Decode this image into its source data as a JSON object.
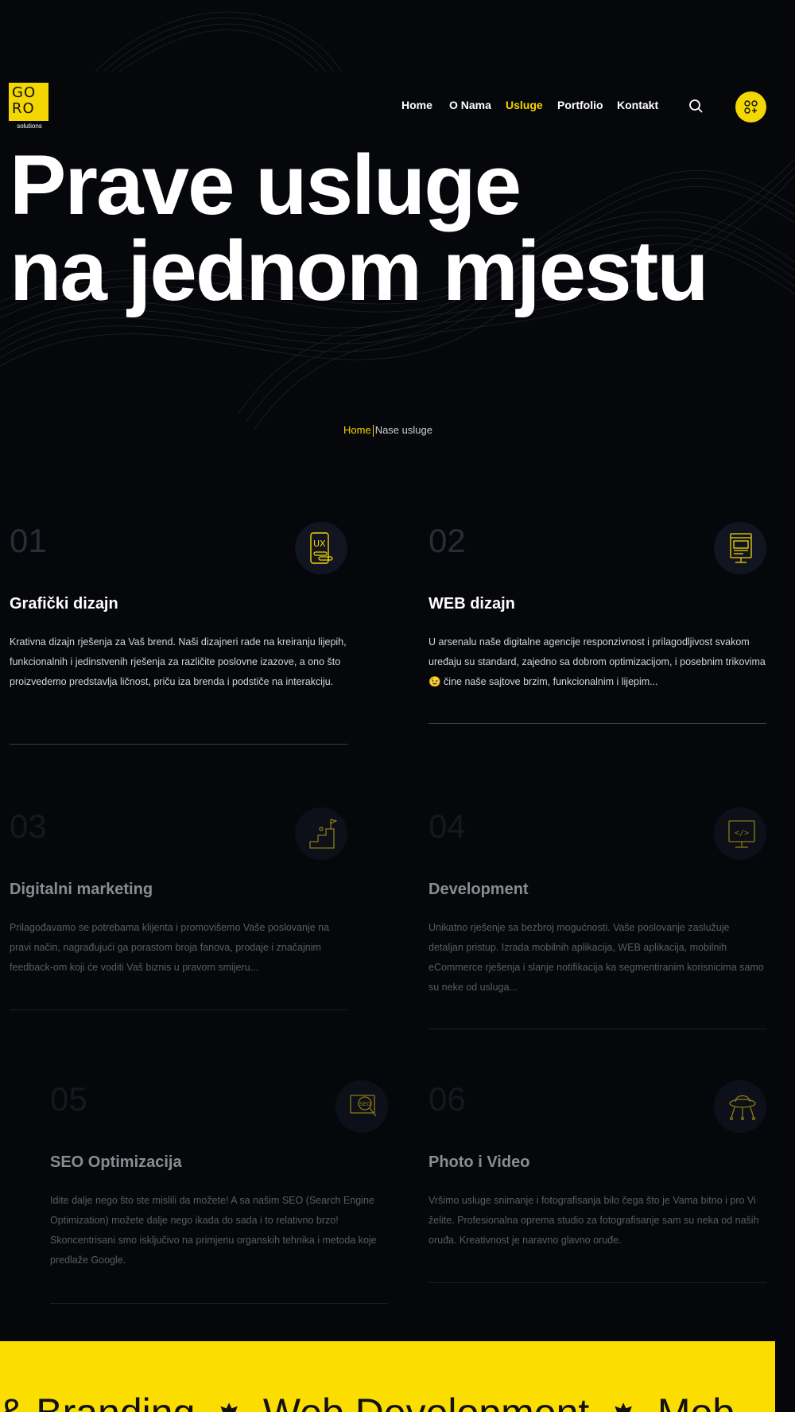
{
  "nav": {
    "logo_text": "GORO solutions",
    "items": [
      "Home",
      "O Nama",
      "Usluge",
      "Portfolio",
      "Kontakt"
    ],
    "active": "Usluge"
  },
  "hero": {
    "line1": "Prave usluge",
    "line2": "na jednom mjestu"
  },
  "breadcrumb": {
    "home": "Home",
    "current": "Nase usluge"
  },
  "services": [
    {
      "num": "01",
      "title": "Grafički dizajn",
      "icon": "ux-phone-icon",
      "text": "Krativna dizajn rješenja za Vaš brend. Naši dizajneri rade na kreiranju lijepih, funkcionalnih i jedinstvenih rješenja za različite poslovne izazove, a ono što proizvedemo predstavlja ličnost, priču iza brenda i podstiče na interakciju."
    },
    {
      "num": "02",
      "title": "WEB dizajn",
      "icon": "monitor-layout-icon",
      "text": "U arsenalu naše digitalne agencije responzivnost i prilagodljivost svakom uređaju su standard, zajedno sa dobrom optimizacijom, i posebnim trikovima 😉 čine naše sajtove brzim, funkcionalnim i lijepim..."
    },
    {
      "num": "03",
      "title": "Digitalni marketing",
      "icon": "climbing-flag-icon",
      "text": "Prilagođavamo se potrebama klijenta i promovišemo Vaše poslovanje na pravi način, nagrađujući ga porastom broja fanova, prodaje i značajnim feedback-om koji će voditi Vaš biznis u pravom smijeru..."
    },
    {
      "num": "04",
      "title": "Development",
      "icon": "code-monitor-icon",
      "text": "Unikatno rješenje sa bezbroj mogućnosti. Vaše poslovanje zaslužuje detaljan pristup. Izrada mobilnih aplikacija, WEB aplikacija, mobilnih eCommerce rješenja i slanje notifikacija ka segmentiranim korisnicima samo su neke od usluga..."
    },
    {
      "num": "05",
      "title": "SEO Optimizacija",
      "icon": "seo-magnifier-icon",
      "text": "Idite dalje nego što ste mislili da možete! A sa našim SEO (Search Engine Optimization) možete dalje nego ikada do sada i to relativno brzo! Skoncentrisani smo isključivo na primjenu organskih tehnika i metoda koje predlaže Google."
    },
    {
      "num": "06",
      "title": "Photo i Video",
      "icon": "ufo-icon",
      "text": "Vršimo usluge snimanje i fotografisanja bilo čega što je Vama bitno i pro Vi želite. Profesionalna oprema studio za fotografisanje sam su neka od naših oruđa. Kreativnost je naravno glavno oruđe."
    }
  ],
  "ticker": {
    "items": [
      "& Branding",
      "Web Development",
      "Mob"
    ],
    "separator": "✸"
  },
  "colors": {
    "accent": "#f4d600",
    "background": "#06070b"
  }
}
